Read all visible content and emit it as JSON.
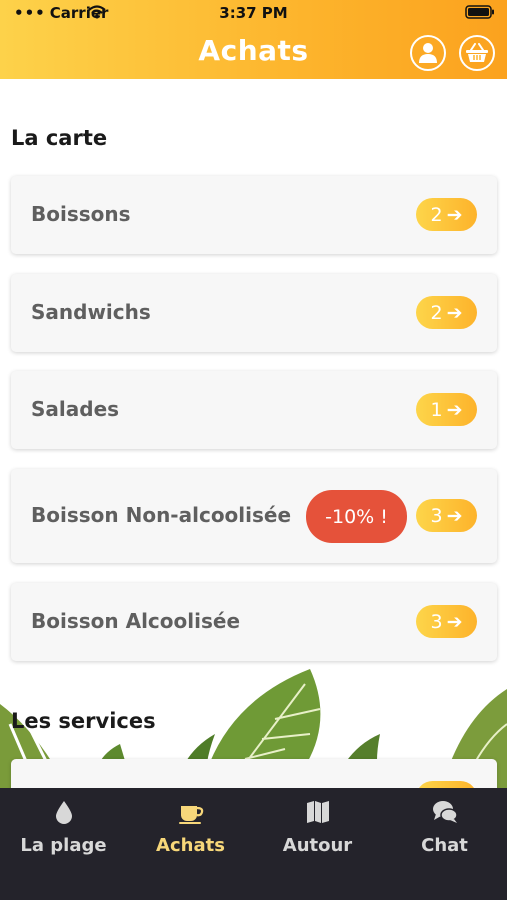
{
  "status_bar": {
    "carrier": "Carrier",
    "time": "3:37 PM"
  },
  "header": {
    "title": "Achats",
    "user_icon": "user-icon",
    "basket_icon": "basket-icon"
  },
  "sections": {
    "carte_title": "La carte",
    "services_title": "Les services"
  },
  "categories": [
    {
      "label": "Boissons",
      "count": "2"
    },
    {
      "label": "Sandwichs",
      "count": "2"
    },
    {
      "label": "Salades",
      "count": "1"
    },
    {
      "label": "Boisson Non-alcoolisée",
      "count": "3",
      "badge": "-10% !"
    },
    {
      "label": "Boisson Alcoolisée",
      "count": "3"
    }
  ],
  "tabs": [
    {
      "label": "La plage",
      "icon": "drop-icon",
      "active": false
    },
    {
      "label": "Achats",
      "icon": "coffee-cup-icon",
      "active": true
    },
    {
      "label": "Autour",
      "icon": "map-icon",
      "active": false
    },
    {
      "label": "Chat",
      "icon": "chat-bubbles-icon",
      "active": false
    }
  ],
  "colors": {
    "header_gradient_start": "#fdd24a",
    "header_gradient_end": "#fba21e",
    "pill": "#fdb32b",
    "promo_badge": "#e5523a",
    "tabbar_bg": "#24232b",
    "tab_active": "#f7d77a",
    "tab_inactive": "#d8d8d8"
  }
}
